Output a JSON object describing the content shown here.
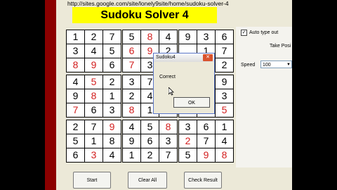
{
  "url": "http://sites.google.com/site/lonely9site/home/sudoku-solver-4",
  "title": "Sudoku Solver 4",
  "grid": [
    [
      {
        "v": "1",
        "r": false
      },
      {
        "v": "2",
        "r": false
      },
      {
        "v": "7",
        "r": false
      },
      {
        "v": "5",
        "r": false
      },
      {
        "v": "8",
        "r": true
      },
      {
        "v": "4",
        "r": false
      },
      {
        "v": "9",
        "r": false
      },
      {
        "v": "3",
        "r": false
      },
      {
        "v": "6",
        "r": false
      }
    ],
    [
      {
        "v": "3",
        "r": false
      },
      {
        "v": "4",
        "r": false
      },
      {
        "v": "5",
        "r": false
      },
      {
        "v": "6",
        "r": true
      },
      {
        "v": "9",
        "r": true
      },
      {
        "v": "2",
        "r": false
      },
      {
        "v": "",
        "r": false
      },
      {
        "v": "1",
        "r": false
      },
      {
        "v": "7",
        "r": false
      }
    ],
    [
      {
        "v": "8",
        "r": true
      },
      {
        "v": "9",
        "r": true
      },
      {
        "v": "6",
        "r": false
      },
      {
        "v": "7",
        "r": true
      },
      {
        "v": "3",
        "r": false
      },
      {
        "v": "",
        "r": false
      },
      {
        "v": "",
        "r": false
      },
      {
        "v": "",
        "r": false
      },
      {
        "v": "2",
        "r": false
      }
    ],
    [
      {
        "v": "4",
        "r": false
      },
      {
        "v": "5",
        "r": true
      },
      {
        "v": "2",
        "r": false
      },
      {
        "v": "3",
        "r": false
      },
      {
        "v": "7",
        "r": false
      },
      {
        "v": "",
        "r": false
      },
      {
        "v": "",
        "r": false
      },
      {
        "v": "",
        "r": false
      },
      {
        "v": "9",
        "r": false
      }
    ],
    [
      {
        "v": "9",
        "r": false
      },
      {
        "v": "8",
        "r": true
      },
      {
        "v": "1",
        "r": false
      },
      {
        "v": "2",
        "r": false
      },
      {
        "v": "4",
        "r": false
      },
      {
        "v": "",
        "r": false
      },
      {
        "v": "",
        "r": false
      },
      {
        "v": "",
        "r": false
      },
      {
        "v": "3",
        "r": false
      }
    ],
    [
      {
        "v": "7",
        "r": true
      },
      {
        "v": "6",
        "r": false
      },
      {
        "v": "3",
        "r": false
      },
      {
        "v": "8",
        "r": true
      },
      {
        "v": "1",
        "r": false
      },
      {
        "v": "",
        "r": false
      },
      {
        "v": "",
        "r": false
      },
      {
        "v": "",
        "r": false
      },
      {
        "v": "5",
        "r": true
      }
    ],
    [
      {
        "v": "2",
        "r": false
      },
      {
        "v": "7",
        "r": false
      },
      {
        "v": "9",
        "r": true
      },
      {
        "v": "4",
        "r": false
      },
      {
        "v": "5",
        "r": false
      },
      {
        "v": "8",
        "r": true
      },
      {
        "v": "3",
        "r": false
      },
      {
        "v": "6",
        "r": false
      },
      {
        "v": "1",
        "r": false
      }
    ],
    [
      {
        "v": "5",
        "r": false
      },
      {
        "v": "1",
        "r": false
      },
      {
        "v": "8",
        "r": false
      },
      {
        "v": "9",
        "r": false
      },
      {
        "v": "6",
        "r": false
      },
      {
        "v": "3",
        "r": false
      },
      {
        "v": "2",
        "r": true
      },
      {
        "v": "7",
        "r": false
      },
      {
        "v": "4",
        "r": false
      }
    ],
    [
      {
        "v": "6",
        "r": false
      },
      {
        "v": "3",
        "r": true
      },
      {
        "v": "4",
        "r": false
      },
      {
        "v": "1",
        "r": false
      },
      {
        "v": "2",
        "r": false
      },
      {
        "v": "7",
        "r": false
      },
      {
        "v": "5",
        "r": false
      },
      {
        "v": "9",
        "r": true
      },
      {
        "v": "8",
        "r": true
      }
    ]
  ],
  "options": {
    "auto_type_label": "Auto type out",
    "auto_type_checked": true,
    "take_label": "Take Posi",
    "speed_label": "Speed",
    "speed_value": "100"
  },
  "buttons": {
    "start": "Start",
    "clear": "Clear All",
    "check": "Check Result"
  },
  "dialog": {
    "title": "Sudoku4",
    "message": "Correct",
    "ok": "OK"
  },
  "colors": {
    "frame": "#8b0000",
    "title_bg": "#ffff00",
    "red_digit": "#d21e1e",
    "window": "#ece9d8"
  }
}
